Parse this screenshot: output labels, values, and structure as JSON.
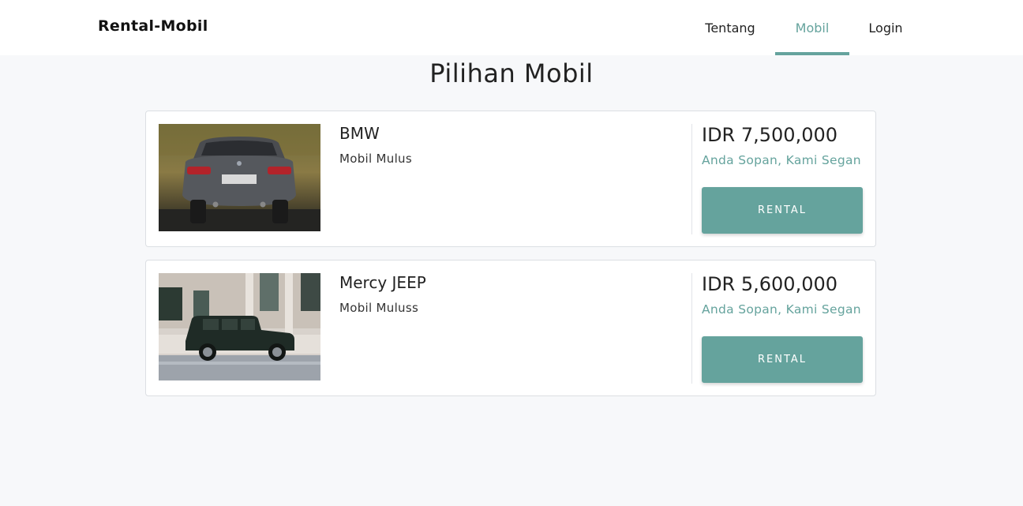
{
  "navbar": {
    "brand": "Rental-Mobil",
    "links": [
      {
        "label": "Tentang",
        "active": false
      },
      {
        "label": "Mobil",
        "active": true
      },
      {
        "label": "Login",
        "active": false
      }
    ]
  },
  "page": {
    "title": "Pilihan Mobil"
  },
  "cars": [
    {
      "name": "BMW",
      "description": "Mobil Mulus",
      "price": "IDR 7,500,000",
      "tagline": "Anda Sopan, Kami Segan",
      "button_label": "RENTAL",
      "image": "bmw-rear-photo"
    },
    {
      "name": "Mercy JEEP",
      "description": "Mobil Muluss",
      "price": "IDR 5,600,000",
      "tagline": "Anda Sopan, Kami Segan",
      "button_label": "RENTAL",
      "image": "mercedes-g-class-side-photo"
    }
  ],
  "colors": {
    "accent": "#65a39d",
    "background": "#f7f8fa"
  }
}
